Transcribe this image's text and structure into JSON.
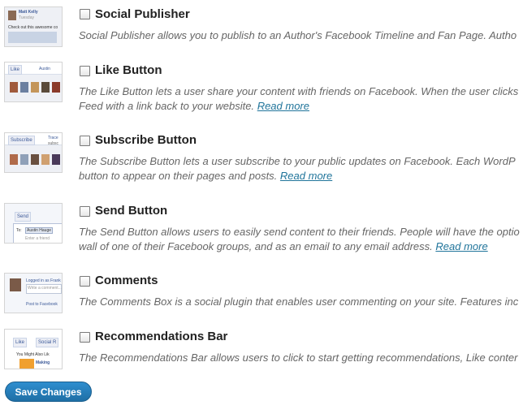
{
  "features": [
    {
      "title": "Social Publisher",
      "lines": [
        "Social Publisher allows you to publish to an Author's Facebook Timeline and Fan Page. Autho"
      ],
      "read_more": "",
      "thumb": {
        "name": "Matt Kelly",
        "sub": "Tuesday",
        "text": "Check out this awesome co"
      }
    },
    {
      "title": "Like Button",
      "lines": [
        "The Like Button lets a user share your content with friends on Facebook. When the user clicks",
        "Feed with a link back to your website."
      ],
      "read_more": "Read more",
      "thumb": {
        "btn": "Like",
        "name": "Austin"
      }
    },
    {
      "title": "Subscribe Button",
      "lines": [
        "The Subscribe Button lets a user subscribe to your public updates on Facebook. Each WordP",
        "button to appear on their pages and posts."
      ],
      "read_more": "Read more",
      "thumb": {
        "btn": "Subscribe",
        "name": "Trace",
        "sub": "subsc"
      }
    },
    {
      "title": "Send Button",
      "lines": [
        "The Send Button allows users to easily send content to their friends. People will have the optio",
        "wall of one of their Facebook groups, and as an email to any email address."
      ],
      "read_more": "Read more",
      "thumb": {
        "btn": "Send",
        "to": "To:",
        "name": "Austin Hauge",
        "placeholder": "Enter a friend"
      }
    },
    {
      "title": "Comments",
      "lines": [
        "The Comments Box is a social plugin that enables user commenting on your site. Features inc"
      ],
      "read_more": "",
      "thumb": {
        "line1": "Logged in as Frank",
        "line2": "Write a comment...",
        "line3": "Post to Facebook"
      }
    },
    {
      "title": "Recommendations Bar",
      "lines": [
        "The Recommendations Bar allows users to click to start getting recommendations, Like conter"
      ],
      "read_more": "",
      "thumb": {
        "btn": "Like",
        "btn2": "Social R",
        "heading": "You Might Also Lik",
        "item": "Making"
      }
    }
  ],
  "save_button": "Save Changes",
  "colors": {
    "link": "#21759b",
    "button": "#2581c4",
    "facebook": "#3b5998"
  }
}
